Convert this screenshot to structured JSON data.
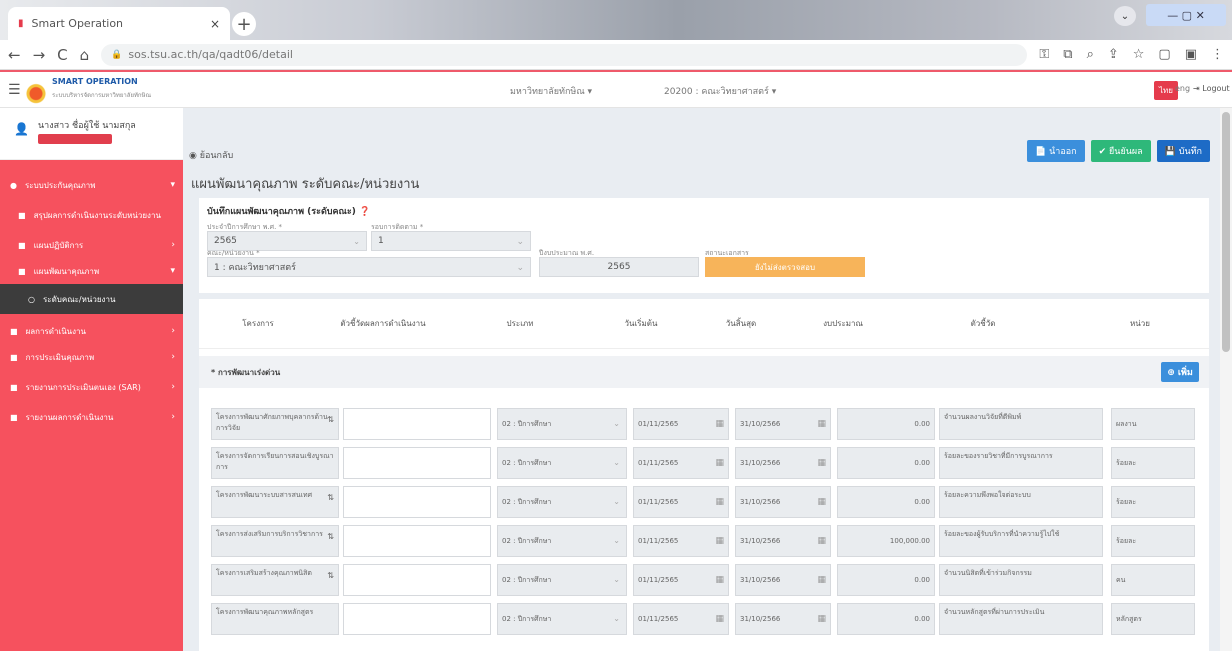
{
  "browser": {
    "tab_title": "Smart Operation",
    "tab_close": "×",
    "new_tab": "+",
    "url": "sos.tsu.ac.th/qa/qadt06/detail",
    "back": "←",
    "forward": "→",
    "reload": "C",
    "home": "⌂",
    "lock": "🔒",
    "window_min": "⌄",
    "window_controls": "—  ▢  ✕"
  },
  "app": {
    "brand": "SMART OPERATION",
    "brand_sub": "ระบบบริหารจัดการมหาวิทยาลัยทักษิณ",
    "header_select1": "มหาวิทยาลัยทักษิณ ▾",
    "header_select2": "20200 : คณะวิทยาศาสตร์ ▾",
    "lang_thai": "ไทย",
    "lang_eng": "eng",
    "logout": "⇥ Logout"
  },
  "user": {
    "name": "นางสาว ชื่อผู้ใช้ นามสกุล"
  },
  "sidebar": {
    "items": [
      {
        "icon": "●",
        "label": "ระบบประกันคุณภาพ",
        "arrow": "▾"
      },
      {
        "icon": "■",
        "label": "สรุปผลการดำเนินงานระดับหน่วยงาน",
        "arrow": ""
      },
      {
        "icon": "■",
        "label": "แผนปฏิบัติการ",
        "arrow": "›"
      },
      {
        "icon": "■",
        "label": "แผนพัฒนาคุณภาพ",
        "arrow": "▾"
      },
      {
        "icon": "○",
        "label": "ระดับคณะ/หน่วยงาน",
        "arrow": ""
      },
      {
        "icon": "■",
        "label": "ผลการดำเนินงาน",
        "arrow": "›"
      },
      {
        "icon": "■",
        "label": "การประเมินคุณภาพ",
        "arrow": "›"
      },
      {
        "icon": "■",
        "label": "รายงานการประเมินตนเอง (SAR)",
        "arrow": "›"
      },
      {
        "icon": "■",
        "label": "รายงานผลการดำเนินงาน",
        "arrow": "›"
      }
    ]
  },
  "toolbar": {
    "back": "◉ ย้อนกลับ",
    "btn_export": "📄 นำออก",
    "btn_confirm": "✔ ยืนยันผล",
    "btn_save": "💾 บันทึก"
  },
  "page": {
    "title": "แผนพัฒนาคุณภาพ ระดับคณะ/หน่วยงาน"
  },
  "form": {
    "card_title": "บันทึกแผนพัฒนาคุณภาพ (ระดับคณะ)",
    "help_icon": "❓",
    "year_label": "ประจำปีการศึกษา พ.ศ. *",
    "year_value": "2565",
    "round_label": "รอบการติดตาม *",
    "round_value": "1",
    "unit_label": "คณะ/หน่วยงาน *",
    "unit_value": "1 : คณะวิทยาศาสตร์",
    "budget_year_label": "ปีงบประมาณ พ.ศ.",
    "budget_year_value": "2565",
    "status_label": "สถานะเอกสาร",
    "status_value": "ยังไม่ส่งตรวจสอบ"
  },
  "table": {
    "headers": [
      "โครงการ",
      "ตัวชี้วัดผลการดำเนินงาน",
      "ประเภท",
      "วันเริ่มต้น",
      "วันสิ้นสุด",
      "งบประมาณ",
      "ตัวชี้วัด",
      "หน่วย"
    ],
    "section_label": "* การพัฒนาเร่งด่วน",
    "add_button": "⊕ เพิ่ม",
    "rows": [
      {
        "project": "โครงการพัฒนาศักยภาพบุคลากรด้านการวิจัย",
        "kpi": "",
        "type": "02 : ปีการศึกษา",
        "start": "01/11/2565",
        "end": "31/10/2566",
        "budget": "0.00",
        "indicator": "จำนวนผลงานวิจัยที่ตีพิมพ์",
        "unit": "ผลงาน"
      },
      {
        "project": "โครงการจัดการเรียนการสอนเชิงบูรณาการ",
        "kpi": "",
        "type": "02 : ปีการศึกษา",
        "start": "01/11/2565",
        "end": "31/10/2566",
        "budget": "0.00",
        "indicator": "ร้อยละของรายวิชาที่มีการบูรณาการ",
        "unit": "ร้อยละ"
      },
      {
        "project": "โครงการพัฒนาระบบสารสนเทศ",
        "kpi": "",
        "type": "02 : ปีการศึกษา",
        "start": "01/11/2565",
        "end": "31/10/2566",
        "budget": "0.00",
        "indicator": "ร้อยละความพึงพอใจต่อระบบ",
        "unit": "ร้อยละ"
      },
      {
        "project": "โครงการส่งเสริมการบริการวิชาการ",
        "kpi": "",
        "type": "02 : ปีการศึกษา",
        "start": "01/11/2565",
        "end": "31/10/2566",
        "budget": "100,000.00",
        "indicator": "ร้อยละของผู้รับบริการที่นำความรู้ไปใช้",
        "unit": "ร้อยละ"
      },
      {
        "project": "โครงการเสริมสร้างคุณภาพนิสิต",
        "kpi": "",
        "type": "02 : ปีการศึกษา",
        "start": "01/11/2565",
        "end": "31/10/2566",
        "budget": "0.00",
        "indicator": "จำนวนนิสิตที่เข้าร่วมกิจกรรม",
        "unit": "คน"
      },
      {
        "project": "โครงการพัฒนาคุณภาพหลักสูตร",
        "kpi": "",
        "type": "02 : ปีการศึกษา",
        "start": "01/11/2565",
        "end": "31/10/2566",
        "budget": "0.00",
        "indicator": "จำนวนหลักสูตรที่ผ่านการประเมิน",
        "unit": "หลักสูตร"
      }
    ]
  },
  "colors": {
    "sidebar": "#f6515e",
    "accent_blue": "#3b8fdc",
    "accent_green": "#2eb87a",
    "status_orange": "#f7b45a"
  }
}
